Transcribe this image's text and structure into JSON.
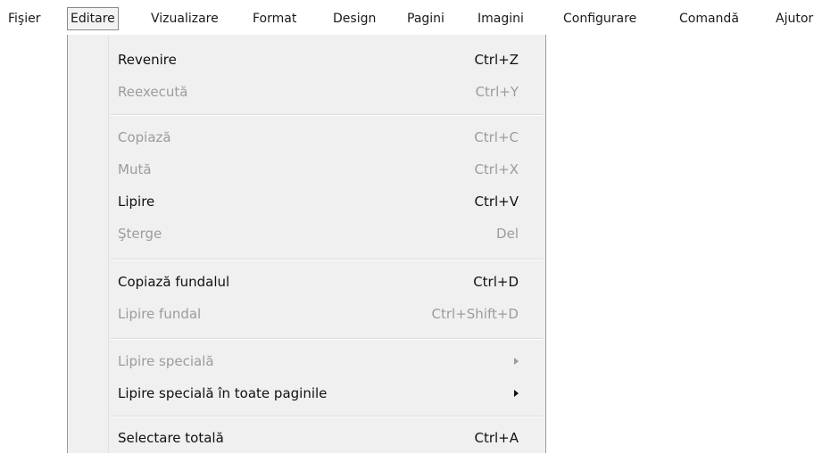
{
  "menubar": {
    "items": [
      {
        "label": "Fişier"
      },
      {
        "label": "Editare",
        "active": true
      },
      {
        "label": "Vizualizare"
      },
      {
        "label": "Format"
      },
      {
        "label": "Design"
      },
      {
        "label": "Pagini"
      },
      {
        "label": "Imagini"
      },
      {
        "label": "Configurare"
      },
      {
        "label": "Comandă"
      },
      {
        "label": "Ajutor"
      }
    ]
  },
  "edit_menu": {
    "items": [
      {
        "label": "Revenire",
        "shortcut": "Ctrl+Z",
        "enabled": true
      },
      {
        "label": "Reexecută",
        "shortcut": "Ctrl+Y",
        "enabled": false
      },
      {
        "label": "Copiază",
        "shortcut": "Ctrl+C",
        "enabled": false
      },
      {
        "label": "Mută",
        "shortcut": "Ctrl+X",
        "enabled": false
      },
      {
        "label": "Lipire",
        "shortcut": "Ctrl+V",
        "enabled": true
      },
      {
        "label": "Şterge",
        "shortcut": "Del",
        "enabled": false
      },
      {
        "label": "Copiază fundalul",
        "shortcut": "Ctrl+D",
        "enabled": true
      },
      {
        "label": "Lipire fundal",
        "shortcut": "Ctrl+Shift+D",
        "enabled": false
      },
      {
        "label": "Lipire specială",
        "has_submenu": true,
        "icon": "chevron-right-icon",
        "enabled": false
      },
      {
        "label": "Lipire specială în toate paginile",
        "has_submenu": true,
        "icon": "chevron-right-icon",
        "enabled": true
      },
      {
        "label": "Selectare totală",
        "shortcut": "Ctrl+A",
        "enabled": true
      }
    ]
  }
}
